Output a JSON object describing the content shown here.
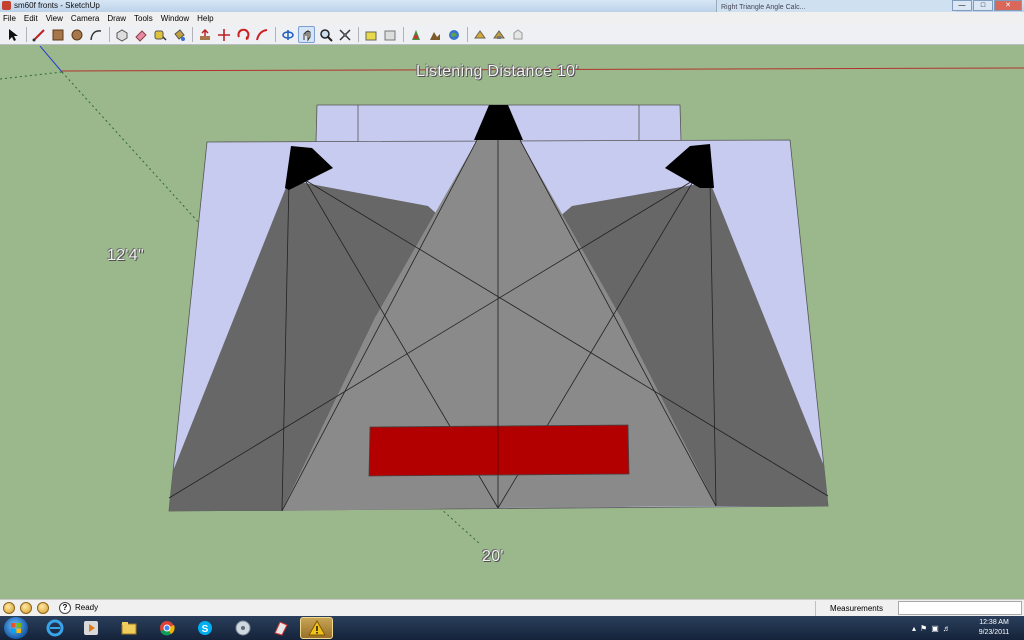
{
  "window": {
    "title": "sm60f fronts - SketchUp",
    "background_tab": "Right Triangle Angle Calc..."
  },
  "menu": [
    "File",
    "Edit",
    "View",
    "Camera",
    "Draw",
    "Tools",
    "Window",
    "Help"
  ],
  "toolbar": {
    "tools": [
      "select-icon",
      "line-icon",
      "rectangle-icon",
      "circle-icon",
      "arc-icon",
      "make-component-icon",
      "eraser-icon",
      "tape-measure-icon",
      "paint-bucket-icon",
      "push-pull-icon",
      "move-icon",
      "rotate-icon",
      "follow-me-icon",
      "orbit-icon",
      "pan-icon",
      "zoom-icon",
      "zoom-extents-icon",
      "3d-warehouse-icon",
      "share-model-icon",
      "get-models-icon",
      "photo-textures-icon",
      "add-location-icon",
      "preview-google-earth-icon",
      "toggle-terrain-icon"
    ]
  },
  "viewport": {
    "dimension_top": "Listening Distance 10'",
    "dimension_left": "12'4\"",
    "dimension_bottom": "20'"
  },
  "colors": {
    "ground": "#9ab88c",
    "wall": "#c7cbf0",
    "cone_light": "#8a8a8a",
    "cone_dark": "#676767",
    "speaker": "#000000",
    "couch": "#b20000"
  },
  "status": {
    "text": "Ready",
    "measurements_label": "Measurements"
  },
  "clock": {
    "time": "12:38 AM",
    "date": "9/23/2011"
  }
}
